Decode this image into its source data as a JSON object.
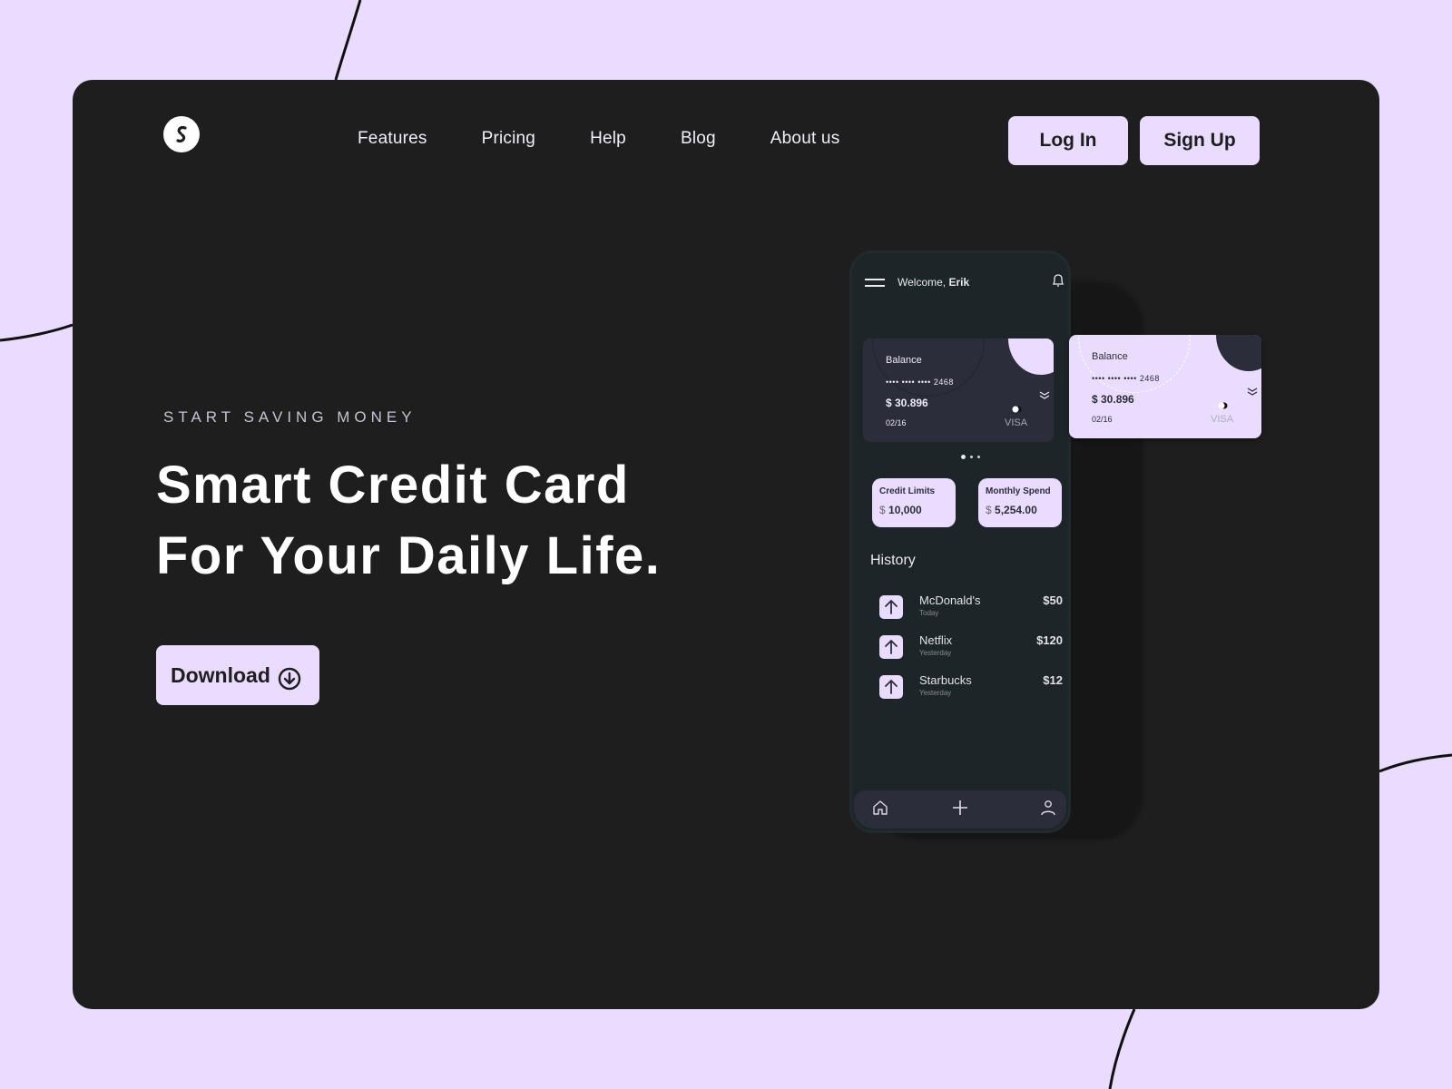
{
  "colors": {
    "background": "#e9dcfe",
    "frame": "#1e1e1e",
    "accent": "#e9dcfe",
    "phone": "#1c2528",
    "card_dark": "#2b2d3b"
  },
  "nav": {
    "logo_icon": "s-swirl-logo-icon",
    "items": [
      "Features",
      "Pricing",
      "Help",
      "Blog",
      "About us"
    ],
    "login_label": "Log In",
    "signup_label": "Sign Up"
  },
  "hero": {
    "eyebrow": "START SAVING MONEY",
    "headline_line1": "Smart Credit Card",
    "headline_line2": "For Your Daily Life.",
    "download_label": "Download",
    "download_icon": "download-circle-icon"
  },
  "phone": {
    "welcome_prefix": "Welcome,",
    "user_name": "Erik",
    "cards": [
      {
        "label": "Balance",
        "number_masked": "•••• •••• ••••",
        "number_last4": "2468",
        "amount": "$ 30.896",
        "expiry": "02/16",
        "brand": "VISA"
      },
      {
        "label": "Balance",
        "number_masked": "•••• •••• ••••",
        "number_last4": "2468",
        "amount": "$ 30.896",
        "expiry": "02/16",
        "brand": "VISA"
      }
    ],
    "carousel": {
      "total": 3,
      "active": 1
    },
    "stats": [
      {
        "label": "Credit Limits",
        "currency": "$",
        "value": "10,000"
      },
      {
        "label": "Monthly Spend",
        "currency": "$",
        "value": "5,254.00"
      }
    ],
    "history_title": "History",
    "history": [
      {
        "name": "McDonald's",
        "date": "Today",
        "amount": "$50"
      },
      {
        "name": "Netflix",
        "date": "Yesterday",
        "amount": "$120"
      },
      {
        "name": "Starbucks",
        "date": "Yesterday",
        "amount": "$12"
      }
    ],
    "tabbar": [
      "home-icon",
      "plus-icon",
      "user-icon"
    ]
  }
}
